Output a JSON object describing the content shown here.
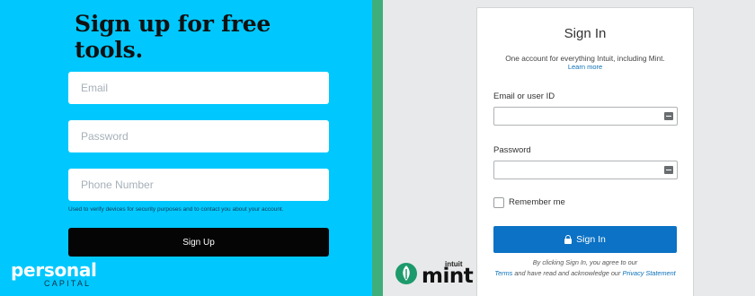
{
  "personal_capital": {
    "headline": "Sign up for free tools.",
    "email_placeholder": "Email",
    "password_placeholder": "Password",
    "phone_placeholder": "Phone Number",
    "phone_note": "Used to verify devices for security purposes and to contact you about your account.",
    "signup_label": "Sign Up",
    "logo_word": "personal",
    "logo_sub": "CAPITAL",
    "colors": {
      "background": "#00c8ff",
      "button": "#050505"
    }
  },
  "mint": {
    "title": "Sign In",
    "subtitle": "One account for everything Intuit, including Mint.",
    "learn_more": "Learn more",
    "email_label": "Email or user ID",
    "password_label": "Password",
    "remember_label": "Remember me",
    "signin_label": "Sign In",
    "legal_pre": "By clicking Sign In, you agree to our",
    "terms_link": "Terms",
    "legal_mid": "and have read and acknowledge our",
    "privacy_link": "Privacy Statement",
    "logo_intuit": "intuit",
    "logo_word": "mint",
    "colors": {
      "button": "#0b72c5",
      "link": "#0a70b8",
      "divider": "#3fae7a"
    }
  }
}
